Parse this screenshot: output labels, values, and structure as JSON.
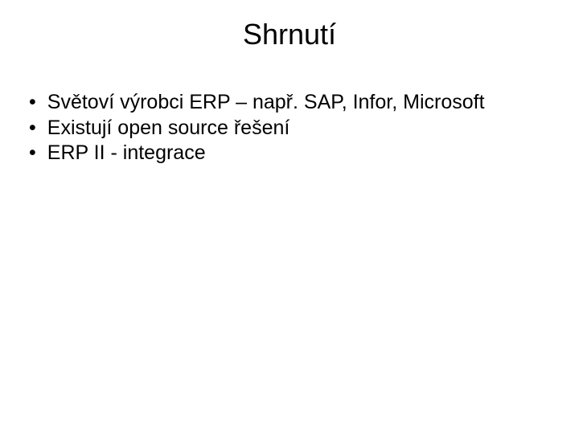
{
  "title": "Shrnutí",
  "bullets": [
    "Světoví výrobci ERP – např. SAP, Infor, Microsoft",
    "Existují open source řešení",
    "ERP II - integrace"
  ]
}
